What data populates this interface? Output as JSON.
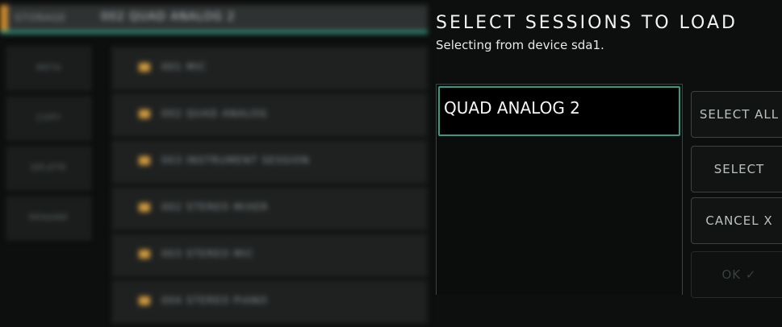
{
  "background": {
    "breadcrumb": "STORAGE",
    "current_session": "002 QUAD ANALOG 2",
    "sidebar": [
      "META",
      "COPY",
      "DELETE",
      "RENAME"
    ],
    "sessions": [
      "001 MIC",
      "002 QUAD ANALOG",
      "003 INSTRUMENT SESSION",
      "002 STEREO MIXER",
      "003 STEREO MIC",
      "004 STEREO PIANO"
    ]
  },
  "dialog": {
    "title": "SELECT SESSIONS TO LOAD",
    "subtitle": "Selecting from device sda1.",
    "sessions": [
      {
        "label": "QUAD ANALOG 2",
        "selected": true
      }
    ],
    "buttons": {
      "select_all": "SELECT ALL",
      "select": "SELECT",
      "cancel": "CANCEL X",
      "ok": "OK ✓"
    }
  },
  "colors": {
    "accent_teal": "#2f9d86",
    "accent_orange": "#c98a2e",
    "background": "#0d0e0e"
  }
}
